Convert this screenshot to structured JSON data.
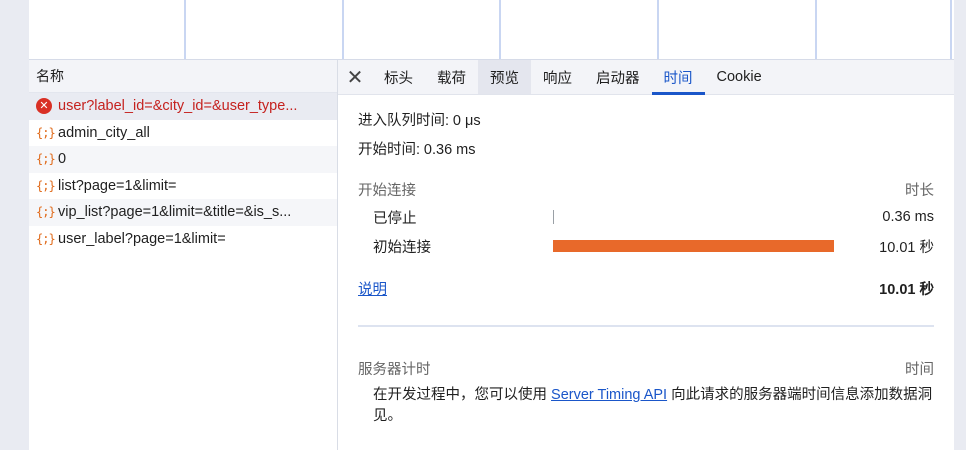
{
  "request_list": {
    "header": "名称",
    "items": [
      {
        "name": "user?label_id=&city_id=&user_type...",
        "status": "error"
      },
      {
        "name": "admin_city_all",
        "status": "ok"
      },
      {
        "name": "0",
        "status": "ok"
      },
      {
        "name": "list?page=1&limit=",
        "status": "ok"
      },
      {
        "name": "vip_list?page=1&limit=&title=&is_s...",
        "status": "ok"
      },
      {
        "name": "user_label?page=1&limit=",
        "status": "ok"
      }
    ]
  },
  "tabs": {
    "close_icon": "✕",
    "items": [
      "标头",
      "载荷",
      "预览",
      "响应",
      "启动器",
      "时间",
      "Cookie"
    ],
    "active": "时间"
  },
  "timing": {
    "queued_label": "进入队列时间:",
    "queued_value": "0 μs",
    "started_label": "开始时间:",
    "started_value": "0.36 ms",
    "connection_section": "开始连接",
    "duration_header": "时长",
    "rows": [
      {
        "label": "已停止",
        "duration": "0.36 ms",
        "fraction": 0.0
      },
      {
        "label": "初始连接",
        "duration": "10.01 秒",
        "fraction": 0.97
      }
    ],
    "explanation_link": "说明",
    "total": "10.01 秒"
  },
  "server_timing": {
    "section": "服务器计时",
    "time_header": "时间",
    "text_before": "在开发过程中，您可以使用 ",
    "link": "Server Timing API",
    "text_after": " 向此请求的服务器端时间信息添加数据洞见。"
  },
  "colors": {
    "accent": "#1a56c9",
    "bar": "#e8692a",
    "error": "#c5221f"
  }
}
